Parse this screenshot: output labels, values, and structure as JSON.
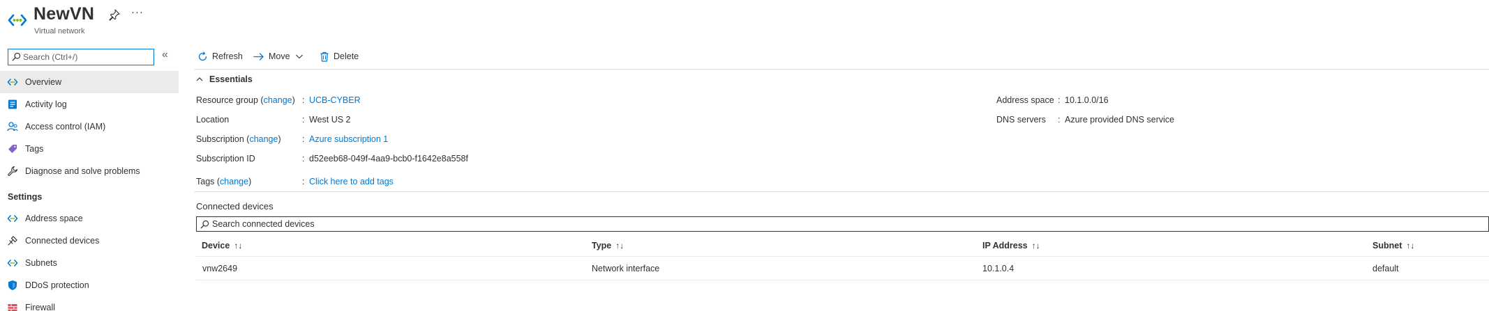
{
  "header": {
    "title": "NewVN",
    "subtitle": "Virtual network",
    "more_label": "···"
  },
  "sidebar": {
    "search_placeholder": "Search (Ctrl+/)",
    "collapse_label": "«",
    "items": [
      {
        "label": "Overview",
        "icon": "virtual-network-icon",
        "active": true
      },
      {
        "label": "Activity log",
        "icon": "activity-log-icon"
      },
      {
        "label": "Access control (IAM)",
        "icon": "access-control-icon"
      },
      {
        "label": "Tags",
        "icon": "tag-icon"
      },
      {
        "label": "Diagnose and solve problems",
        "icon": "wrench-icon"
      }
    ],
    "settings_heading": "Settings",
    "settings_items": [
      {
        "label": "Address space",
        "icon": "address-space-icon"
      },
      {
        "label": "Connected devices",
        "icon": "connected-devices-icon"
      },
      {
        "label": "Subnets",
        "icon": "subnets-icon"
      },
      {
        "label": "DDoS protection",
        "icon": "shield-icon"
      },
      {
        "label": "Firewall",
        "icon": "firewall-icon"
      }
    ]
  },
  "toolbar": {
    "refresh_label": "Refresh",
    "move_label": "Move",
    "delete_label": "Delete"
  },
  "essentials": {
    "heading": "Essentials",
    "left": [
      {
        "label": "Resource group",
        "change": "change",
        "value": "UCB-CYBER",
        "value_is_link": true
      },
      {
        "label": "Location",
        "value": "West US 2"
      },
      {
        "label": "Subscription",
        "change": "change",
        "value": "Azure subscription 1",
        "value_is_link": true
      },
      {
        "label": "Subscription ID",
        "value": "d52eeb68-049f-4aa9-bcb0-f1642e8a558f"
      },
      {
        "label": "Tags",
        "change": "change",
        "value": "Click here to add tags",
        "value_is_link": true
      }
    ],
    "right": [
      {
        "label": "Address space",
        "value": "10.1.0.0/16"
      },
      {
        "label": "DNS servers",
        "value": "Azure provided DNS service"
      }
    ]
  },
  "connected_devices": {
    "title": "Connected devices",
    "search_placeholder": "Search connected devices",
    "columns": [
      "Device",
      "Type",
      "IP Address",
      "Subnet"
    ],
    "sort_glyph": "↑↓",
    "rows": [
      {
        "device": "vnw2649",
        "type": "Network interface",
        "ip": "10.1.0.4",
        "subnet": "default"
      }
    ]
  },
  "colors": {
    "accent": "#0078d4",
    "active_bg": "#edebe9",
    "text": "#323130"
  }
}
